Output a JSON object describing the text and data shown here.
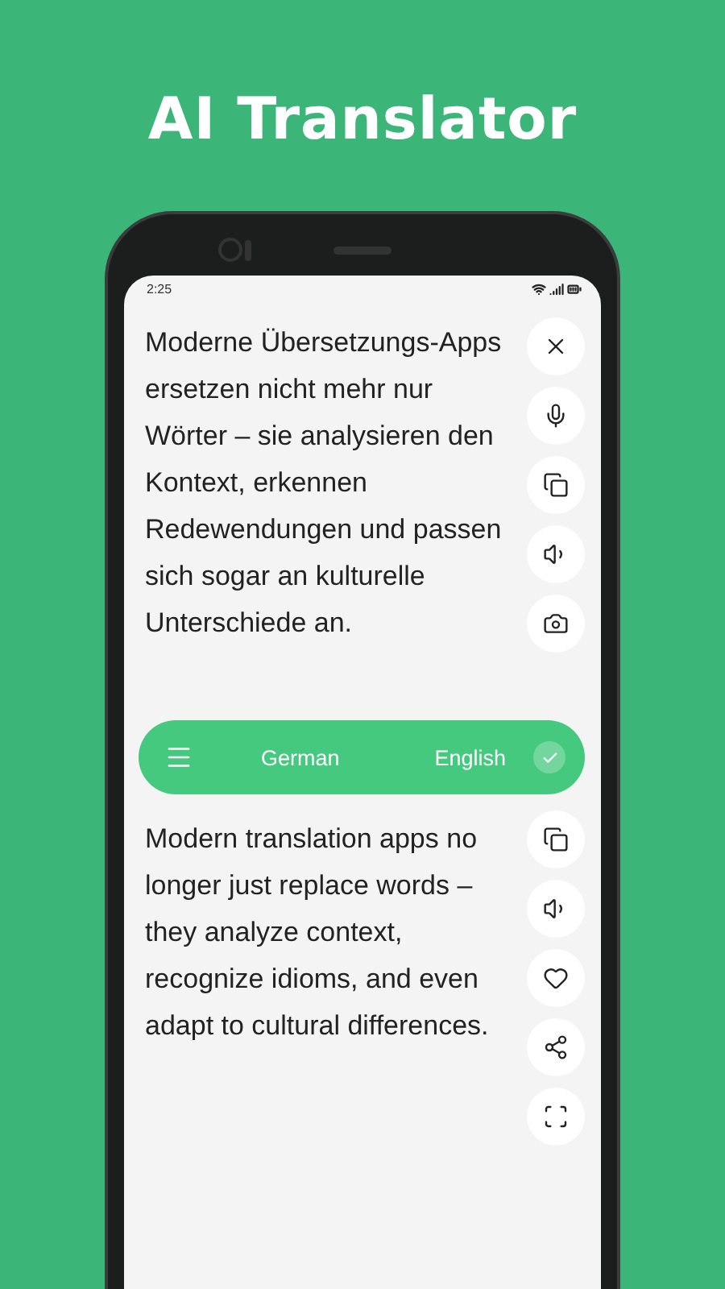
{
  "headline": "AI Translator",
  "status_bar": {
    "time": "2:25"
  },
  "source": {
    "text": "Moderne Übersetzungs-Apps ersetzen nicht mehr nur Wörter – sie analysieren den Kontext, erkennen Redewendungen und passen sich sogar an kulturelle Unterschiede an."
  },
  "language_bar": {
    "source_language": "German",
    "target_language": "English"
  },
  "target": {
    "text": "Modern translation apps no longer just replace words – they analyze context, recognize idioms, and even adapt to cultural differences."
  }
}
